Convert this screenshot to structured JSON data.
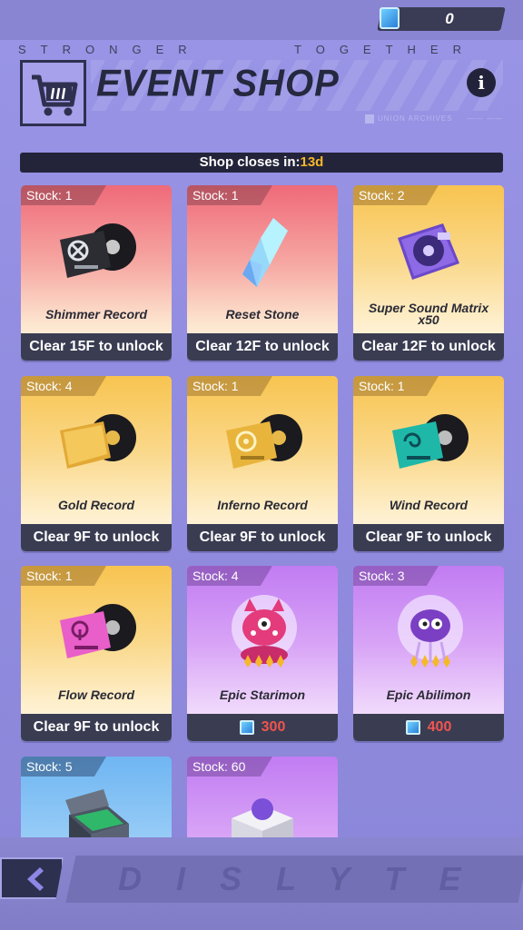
{
  "currency": {
    "value": "0",
    "icon": "ticket-icon"
  },
  "header": {
    "tagline_left": "STRONGER",
    "tagline_right": "TOGETHER",
    "title": "EVENT SHOP",
    "info_icon": "i",
    "union_tag": "UNION ARCHIVES",
    "union_ver": "—— ——"
  },
  "timer": {
    "label": "Shop closes in:",
    "value": "13d"
  },
  "items": [
    {
      "stock": "Stock:  1",
      "name": "Shimmer Record",
      "footer": "Clear 15F to unlock",
      "theme": "red"
    },
    {
      "stock": "Stock:  1",
      "name": "Reset Stone",
      "footer": "Clear 12F to unlock",
      "theme": "red"
    },
    {
      "stock": "Stock:  2",
      "name": "Super Sound Matrix x50",
      "footer": "Clear 12F to unlock",
      "theme": "gold"
    },
    {
      "stock": "Stock:  4",
      "name": "Gold Record",
      "footer": "Clear 9F to unlock",
      "theme": "gold"
    },
    {
      "stock": "Stock:  1",
      "name": "Inferno Record",
      "footer": "Clear 9F to unlock",
      "theme": "gold"
    },
    {
      "stock": "Stock:  1",
      "name": "Wind Record",
      "footer": "Clear 9F to unlock",
      "theme": "gold"
    },
    {
      "stock": "Stock:  1",
      "name": "Flow Record",
      "footer": "Clear 9F to unlock",
      "theme": "gold"
    },
    {
      "stock": "Stock:  4",
      "name": "Epic Starimon",
      "price": "300",
      "theme": "purple"
    },
    {
      "stock": "Stock:  3",
      "name": "Epic Abilimon",
      "price": "400",
      "theme": "purple"
    },
    {
      "stock": "Stock:  5",
      "name": "",
      "theme": "blue"
    },
    {
      "stock": "Stock:  60",
      "name": "",
      "theme": "purple"
    }
  ],
  "footer": {
    "back_icon": "chevron-left-icon",
    "brand": "DISLYTE"
  },
  "colors": {
    "accent": "#f5b82a",
    "price": "#f0554e",
    "panel": "#3a3c52"
  }
}
